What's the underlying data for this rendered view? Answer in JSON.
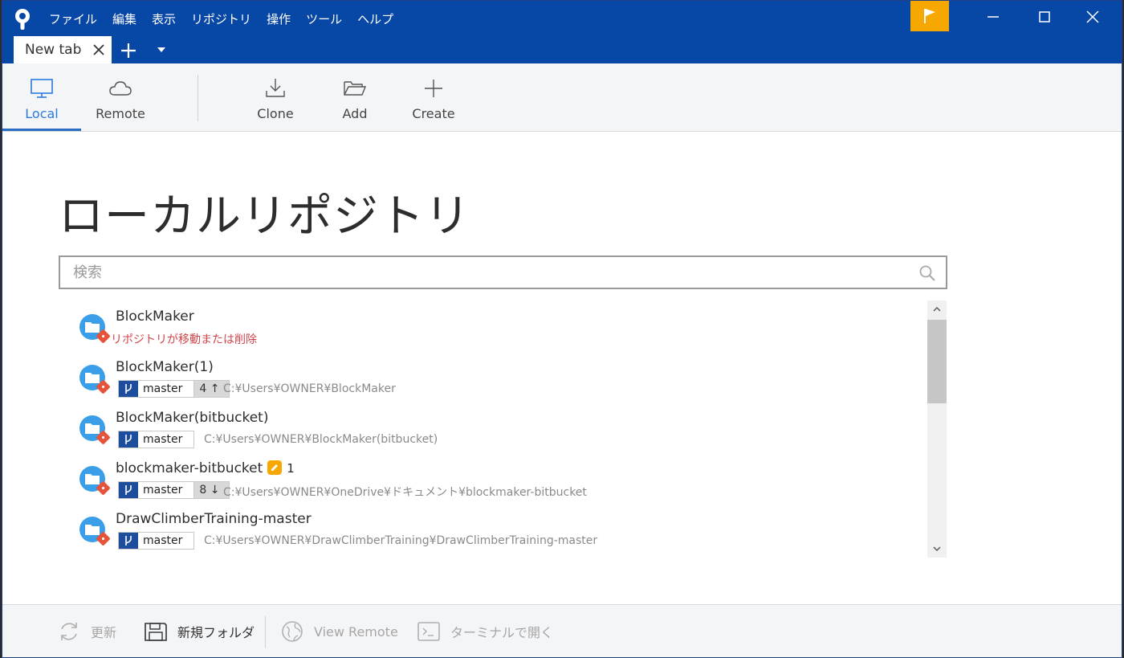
{
  "menu": [
    "ファイル",
    "編集",
    "表示",
    "リポジトリ",
    "操作",
    "ツール",
    "ヘルプ"
  ],
  "tab": {
    "label": "New tab"
  },
  "toolbar": {
    "local": "Local",
    "remote": "Remote",
    "clone": "Clone",
    "add": "Add",
    "create": "Create"
  },
  "page": {
    "title": "ローカルリポジトリ",
    "search_placeholder": "検索"
  },
  "repos": [
    {
      "name": "BlockMaker",
      "error": "リポジトリが移動または削除"
    },
    {
      "name": "BlockMaker(1)",
      "branch": "master",
      "count": "4 ↑",
      "path": "C:¥Users¥OWNER¥BlockMaker"
    },
    {
      "name": "BlockMaker(bitbucket)",
      "branch": "master",
      "path": "C:¥Users¥OWNER¥BlockMaker(bitbucket)"
    },
    {
      "name": "blockmaker-bitbucket",
      "modified": "1",
      "branch": "master",
      "count": "8 ↓",
      "path": "C:¥Users¥OWNER¥OneDrive¥ドキュメント¥blockmaker-bitbucket"
    },
    {
      "name": "DrawClimberTraining-master",
      "branch": "master",
      "path": "C:¥Users¥OWNER¥DrawClimberTraining¥DrawClimberTraining-master"
    }
  ],
  "bottombar": {
    "refresh": "更新",
    "new_folder": "新規フォルダ",
    "view_remote": "View Remote",
    "terminal": "ターミナルで開く"
  },
  "colors": {
    "titlebar": "#0747a6",
    "accent": "#2b7be0",
    "flag": "#f7a800",
    "error": "#d0454a",
    "branch_icon": "#1d4e9e"
  }
}
